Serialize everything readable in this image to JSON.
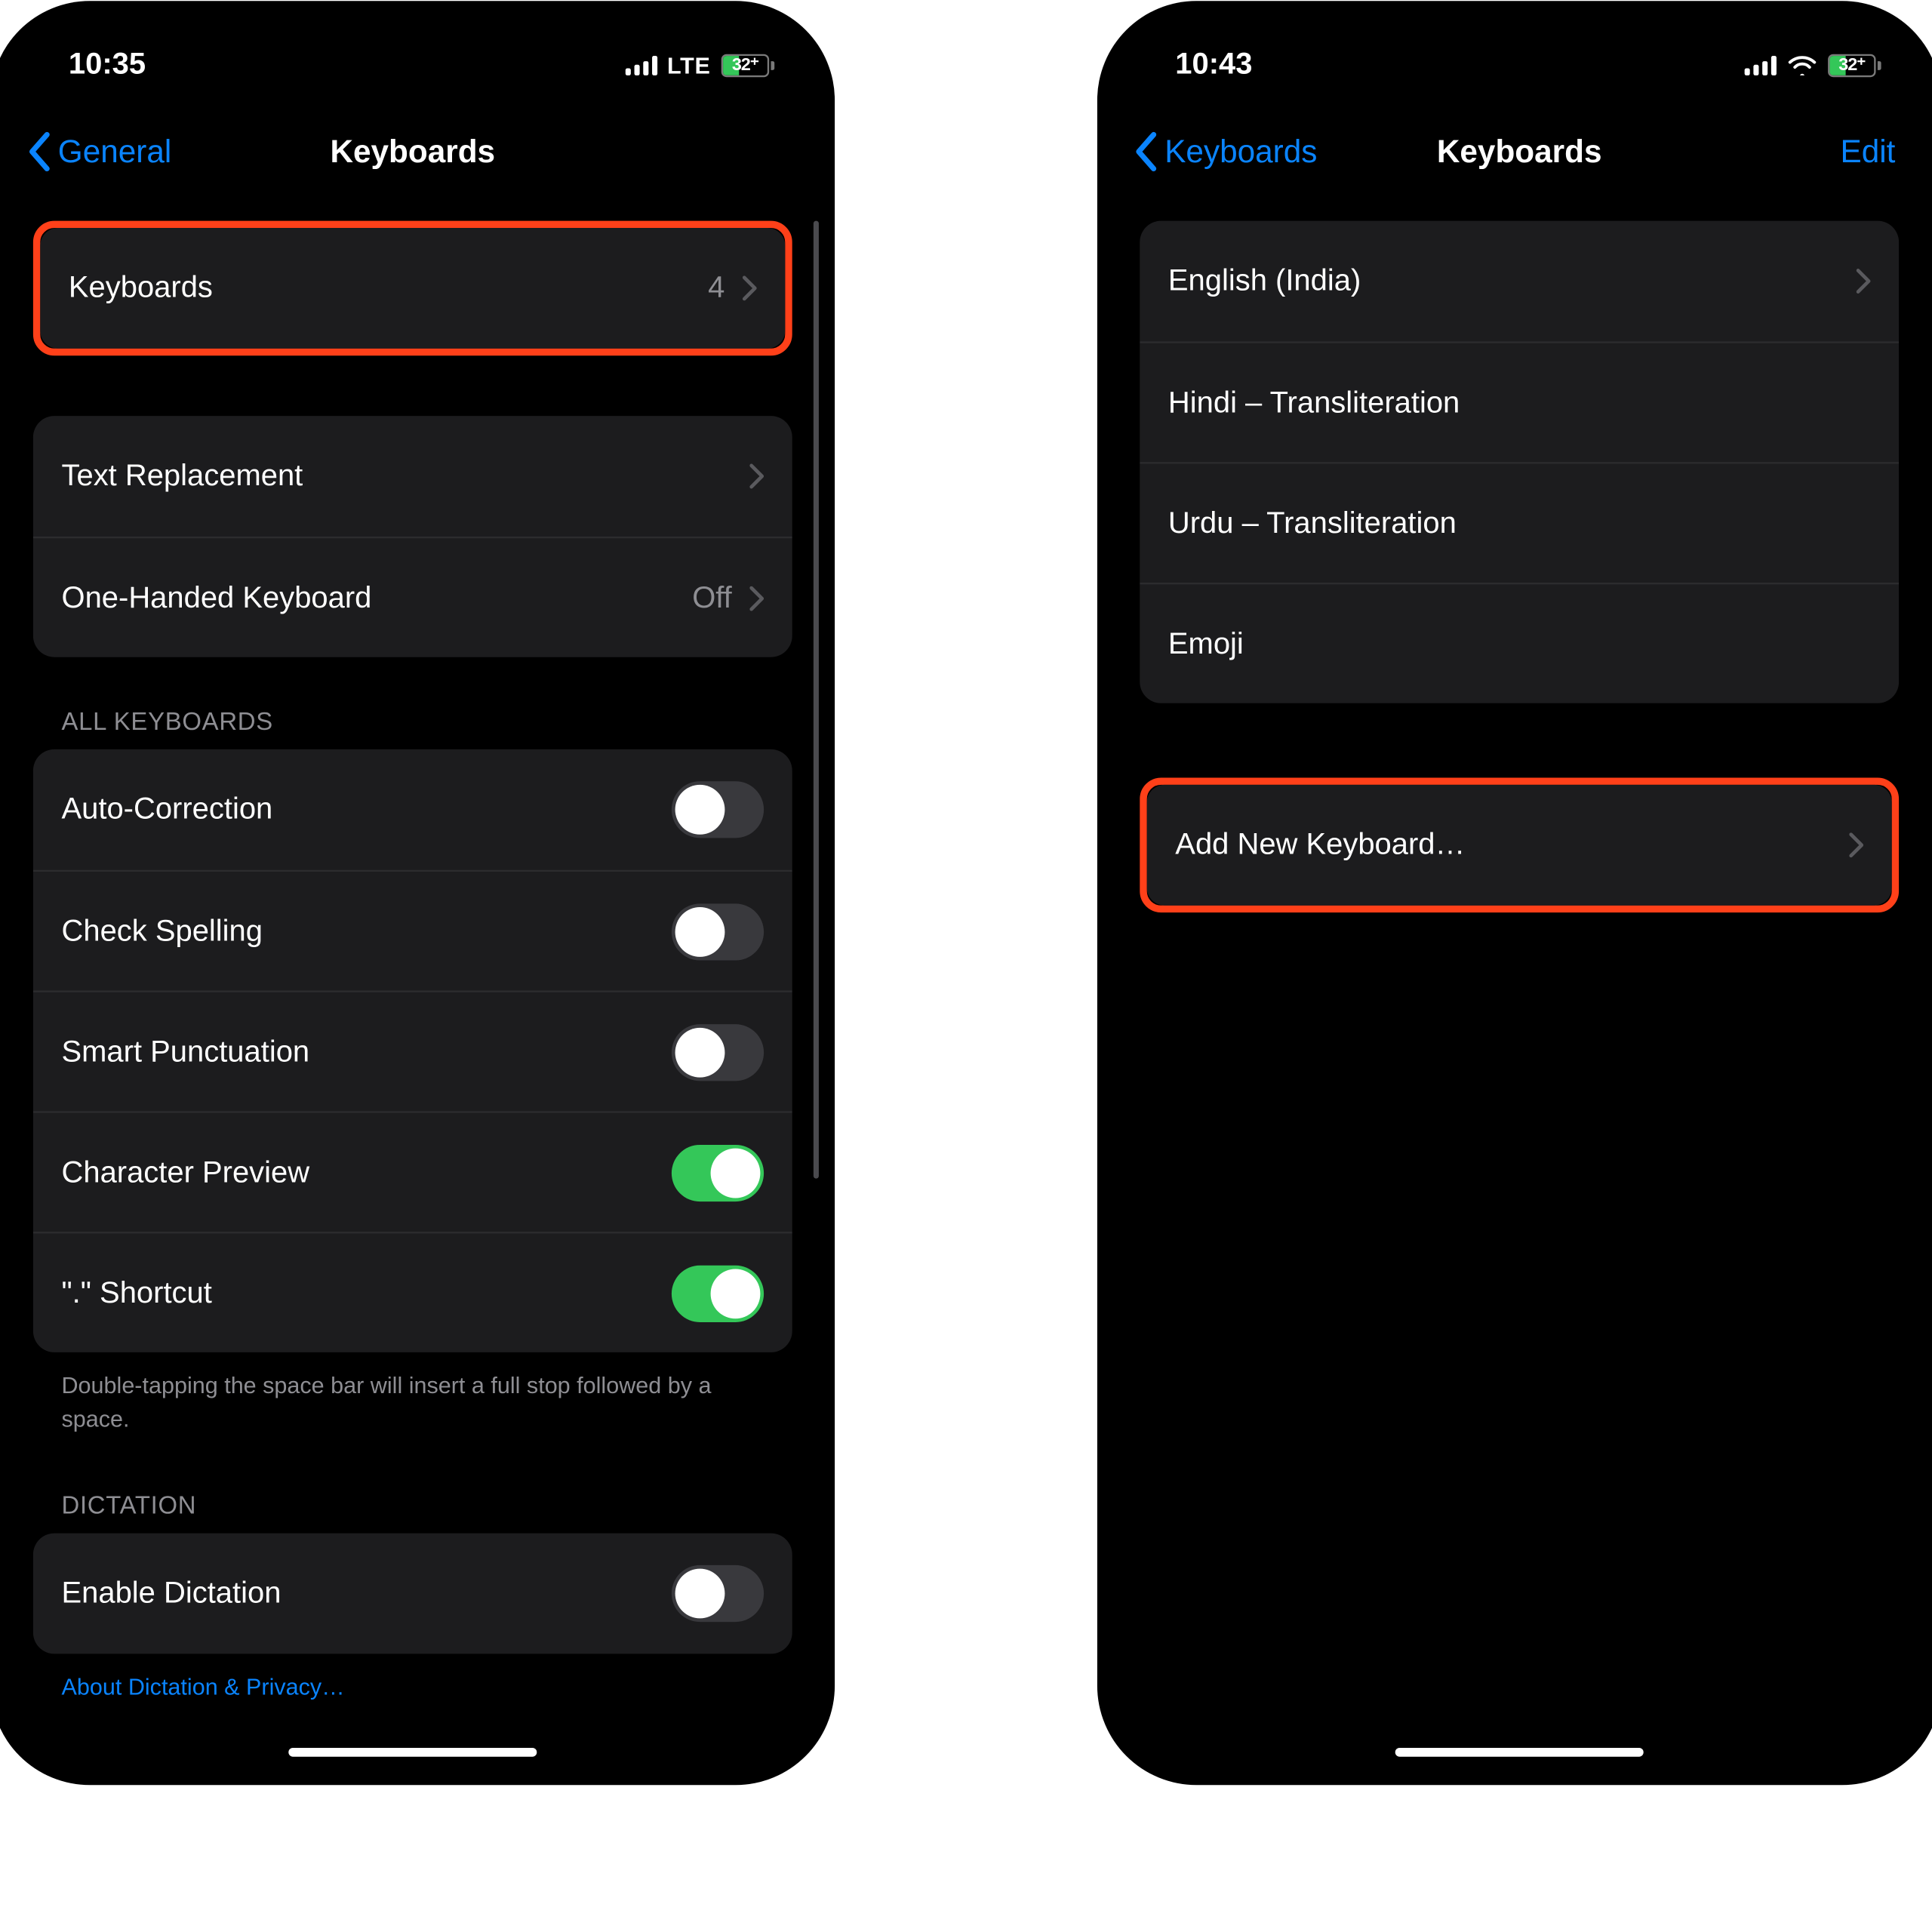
{
  "left": {
    "status": {
      "time": "10:35",
      "network": "LTE",
      "battery": "32"
    },
    "nav": {
      "back": "General",
      "title": "Keyboards"
    },
    "topCell": {
      "label": "Keyboards",
      "value": "4"
    },
    "group2": {
      "textReplacement": "Text Replacement",
      "oneHanded": {
        "label": "One-Handed Keyboard",
        "value": "Off"
      }
    },
    "allKeyboardsHeader": "All Keyboards",
    "switches": {
      "autoCorrection": {
        "label": "Auto-Correction",
        "on": false
      },
      "checkSpelling": {
        "label": "Check Spelling",
        "on": false
      },
      "smartPunctuation": {
        "label": "Smart Punctuation",
        "on": false
      },
      "characterPreview": {
        "label": "Character Preview",
        "on": true
      },
      "shortcut": {
        "label": "\".\" Shortcut",
        "on": true
      }
    },
    "footer1": "Double-tapping the space bar will insert a full stop followed by a space.",
    "dictationHeader": "Dictation",
    "enableDictation": {
      "label": "Enable Dictation",
      "on": false
    },
    "aboutDictation": "About Dictation & Privacy…"
  },
  "right": {
    "status": {
      "time": "10:43",
      "battery": "32"
    },
    "nav": {
      "back": "Keyboards",
      "title": "Keyboards",
      "edit": "Edit"
    },
    "keyboards": {
      "k0": "English (India)",
      "k1": "Hindi – Transliteration",
      "k2": "Urdu – Transliteration",
      "k3": "Emoji"
    },
    "addNew": "Add New Keyboard…"
  }
}
